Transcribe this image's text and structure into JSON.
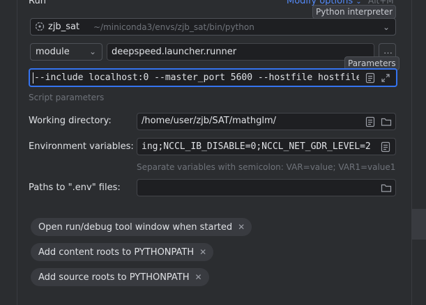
{
  "header": {
    "title": "Run",
    "modify_options": "Modify options",
    "shortcut": "Alt+M"
  },
  "tooltips": {
    "python_interpreter": "Python interpreter",
    "parameters": "Parameters"
  },
  "interpreter": {
    "name": "zjb_sat",
    "path": "~/miniconda3/envs/zjb_sat/bin/python"
  },
  "run_target": {
    "type": "module",
    "module_name": "deepspeed.launcher.runner"
  },
  "script_parameters": {
    "value": "--include localhost:0 --master_port 5600 --hostfile hostfile",
    "label": "Script parameters"
  },
  "working_directory": {
    "label": "Working directory:",
    "value": "/home/user/zjb/SAT/mathglm/"
  },
  "environment_variables": {
    "label": "Environment variables:",
    "value": "ing;NCCL_IB_DISABLE=0;NCCL_NET_GDR_LEVEL=2",
    "hint": "Separate variables with semicolon: VAR=value; VAR1=value1"
  },
  "env_files": {
    "label": "Paths to \".env\" files:",
    "value": ""
  },
  "options": [
    {
      "label": "Open run/debug tool window when started"
    },
    {
      "label": "Add content roots to PYTHONPATH"
    },
    {
      "label": "Add source roots to PYTHONPATH"
    }
  ],
  "colors": {
    "background": "#2b2d30",
    "field": "#1e1f22",
    "focus": "#3574f0",
    "link": "#548af7",
    "chip": "#393b40"
  }
}
